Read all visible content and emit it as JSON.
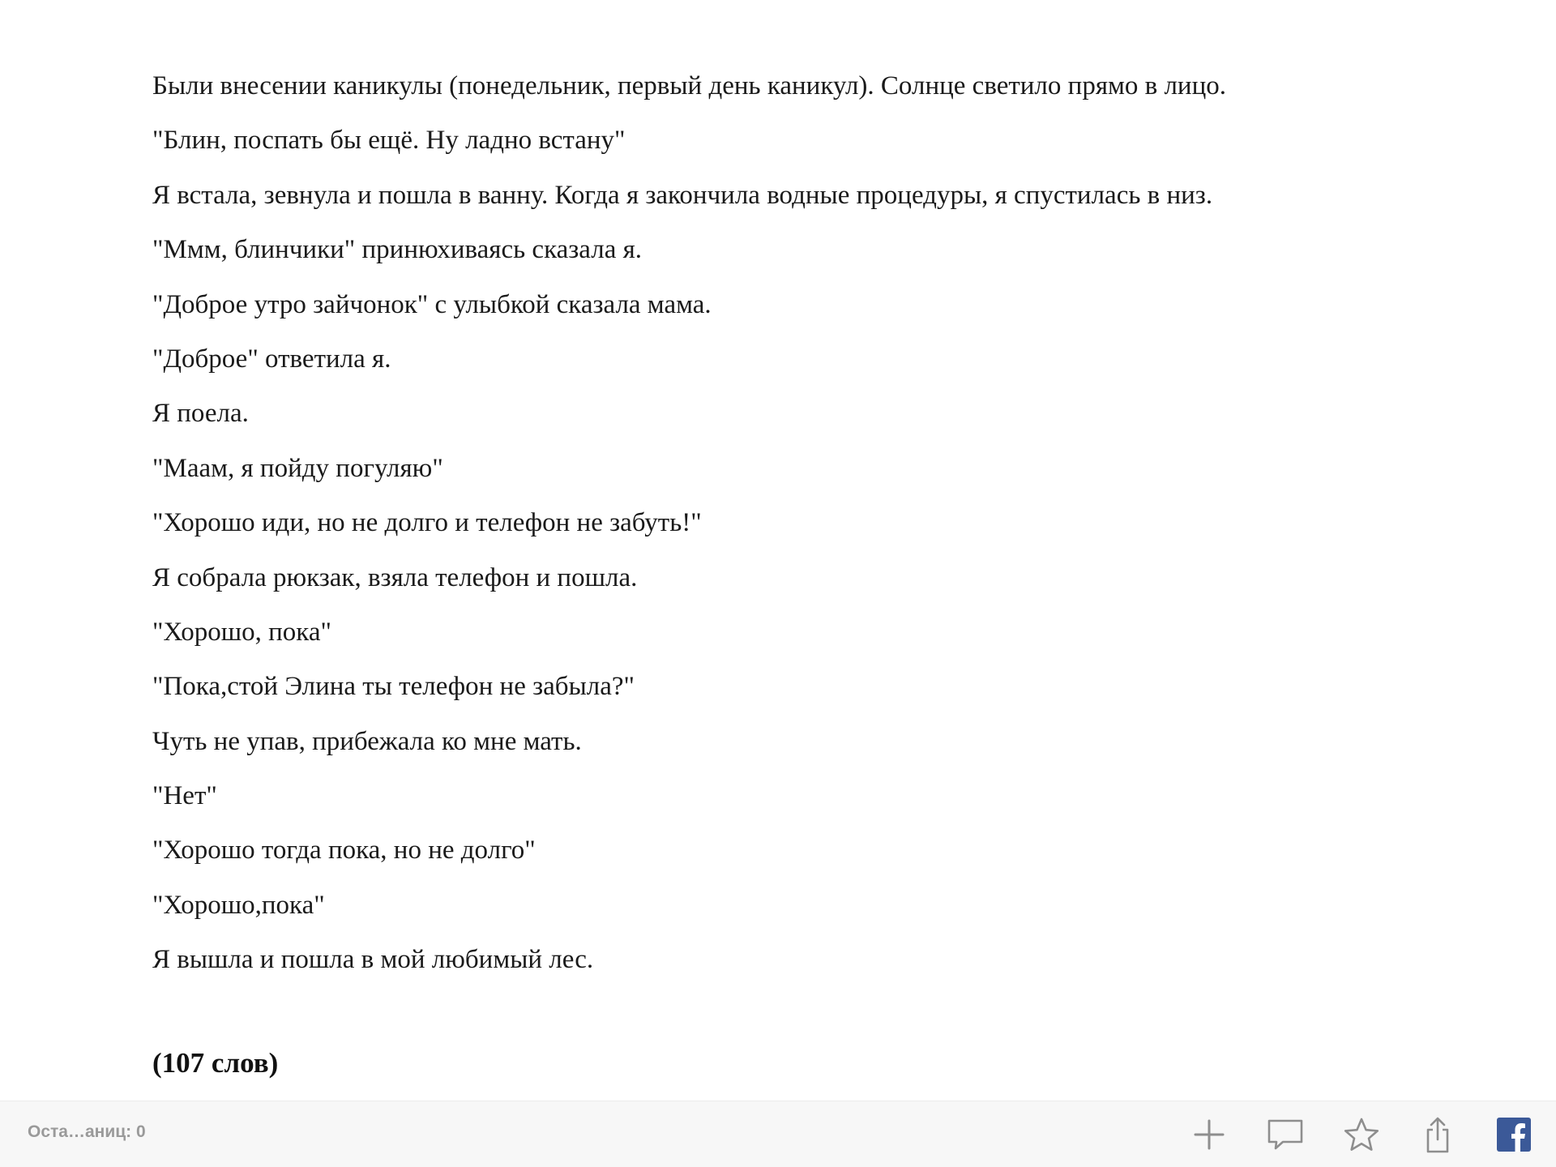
{
  "story": {
    "paragraphs": [
      "Были внесении каникулы (понедельник, первый день каникул). Солнце светило прямо в лицо.",
      "\"Блин, поспать бы ещё. Ну ладно встану\"",
      "Я встала, зевнула и пошла в ванну. Когда я закончила водные процедуры, я спустилась в низ.",
      "\"Ммм, блинчики\" принюхиваясь сказала я.",
      "\"Доброе утро зайчонок\" с улыбкой сказала мама.",
      "\"Доброе\" ответила я.",
      "Я поела.",
      "\"Маам, я пойду погуляю\"",
      "\"Хорошо иди, но не долго и телефон не забуть!\"",
      "Я собрала рюкзак, взяла телефон и пошла.",
      "\"Хорошо, пока\"",
      "\"Пока,стой Элина ты телефон не забыла?\"",
      "Чуть не упав, прибежала ко мне мать.",
      "\"Нет\"",
      "\"Хорошо тогда пока, но не долго\"",
      "\"Хорошо,пока\"",
      "Я вышла и пошла в мой любимый лес."
    ],
    "word_count": "(107 слов)"
  },
  "toolbar": {
    "pages_left_label": "Оста…аниц: 0",
    "icons": {
      "add": "plus-icon",
      "comment": "comment-icon",
      "favorite": "star-icon",
      "share": "share-icon",
      "facebook": "facebook-icon"
    },
    "colors": {
      "icon": "#8e8e8e",
      "facebook": "#3b5998",
      "background": "#f7f7f7",
      "label": "#9a9a9a"
    }
  }
}
